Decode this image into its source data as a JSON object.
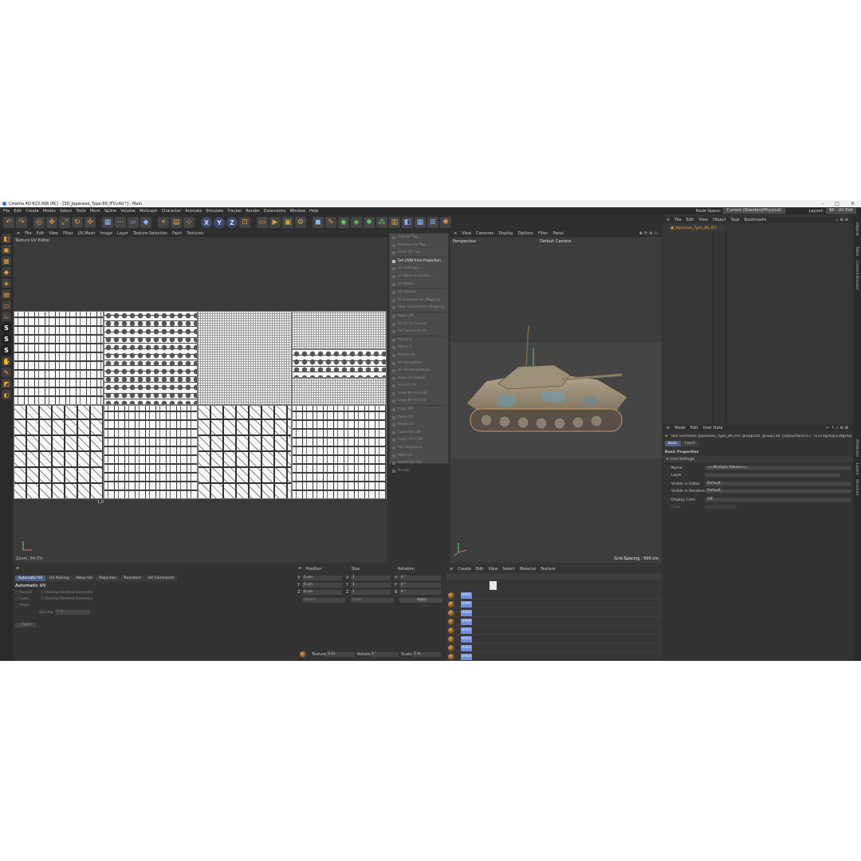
{
  "window": {
    "title": "Cinema 4D R23.008 (RC) - [3D_Japanese_Type-89_IFV.c4d *] - Main",
    "controls": [
      "–",
      "□",
      "✕"
    ]
  },
  "menubar": {
    "items": [
      "File",
      "Edit",
      "Create",
      "Modes",
      "Select",
      "Tools",
      "Mesh",
      "Spline",
      "Volume",
      "MoGraph",
      "Character",
      "Animate",
      "Simulate",
      "Tracker",
      "Render",
      "Extensions",
      "Window",
      "Help"
    ],
    "node_space_label": "Node Space:",
    "node_space_value": "Current (Standard/Physical)",
    "layout_label": "Layout:",
    "layout_value": "BP - UV Edit"
  },
  "uv_panel": {
    "menu": [
      "File",
      "Edit",
      "View",
      "Filter",
      "UV Mesh",
      "Image",
      "Layer",
      "Texture Selection",
      "Paint",
      "Textures"
    ],
    "title": "Texture UV Editor",
    "label_top_right": "1",
    "label_bottom": "1,0",
    "zoom": "Zoom: 64.0%"
  },
  "uv_menu": {
    "items": [
      {
        "label": "Add UV Tag",
        "active": false
      },
      {
        "label": "Remove UV Tag",
        "active": false
      },
      {
        "label": "Clear UV Tag",
        "active": false
      },
      {
        "sep": true
      },
      {
        "label": "Set UVW from Projection...",
        "active": true
      },
      {
        "label": "UV Settings...",
        "active": false
      },
      {
        "label": "UV Mesh to Points...",
        "active": false
      },
      {
        "label": "UV Mesh",
        "active": false
      },
      {
        "sep": true
      },
      {
        "label": "UV Islands",
        "active": false
      },
      {
        "label": "Fit Selected for Mapping",
        "active": false
      },
      {
        "label": "Stop Selected for Mapping",
        "active": false
      },
      {
        "sep": true
      },
      {
        "label": "Relax UV",
        "active": false
      },
      {
        "label": "Fit UV to Canvas",
        "active": false
      },
      {
        "label": "Fit Canvas to UV",
        "active": false
      },
      {
        "sep": true
      },
      {
        "label": "Mirror U",
        "active": false
      },
      {
        "label": "Mirror V",
        "active": false
      },
      {
        "label": "Rotate UV",
        "active": false
      },
      {
        "label": "UV Straighten",
        "active": false
      },
      {
        "label": "UV Rectangularize",
        "active": false
      },
      {
        "label": "Align UV Islands",
        "active": false
      },
      {
        "label": "Stretch UV",
        "active": false
      },
      {
        "label": "Snap Pin on Grid",
        "active": false
      },
      {
        "label": "Snap Pin to Grid",
        "active": false
      },
      {
        "sep": true
      },
      {
        "label": "Copy UV",
        "active": false
      },
      {
        "label": "Paste UV",
        "active": false
      },
      {
        "label": "Reset UV",
        "active": false
      },
      {
        "label": "Cycle UV CW",
        "active": false
      },
      {
        "label": "Cycle UV CCW",
        "active": false
      },
      {
        "label": "Flip Sequence",
        "active": false
      },
      {
        "label": "Weld UV",
        "active": false
      },
      {
        "label": "Subdivide UV",
        "active": false
      },
      {
        "label": "Terrain",
        "active": false
      }
    ]
  },
  "viewport": {
    "menu": [
      "View",
      "Cameras",
      "Display",
      "Options",
      "Filter",
      "Panel"
    ],
    "view_label": "Perspective",
    "camera_label": "Default Camera",
    "grid_spacing": "Grid Spacing : 500 cm"
  },
  "objects": {
    "menu": [
      "File",
      "Edit",
      "View",
      "Object",
      "Tags",
      "Bookmarks"
    ],
    "object_name": "Japanese_Type_89_IFV"
  },
  "right_tabs": [
    "Objects",
    "Takes",
    "Content Browser",
    "Attributes",
    "Layers",
    "Structure"
  ],
  "attributes": {
    "menu": [
      "Mode",
      "Edit",
      "User Data"
    ],
    "summary": "604 Elements [Japanese_Type_89_IFV, group120, group136, polySurface157, TE371group139group152polySurf...",
    "tabs": [
      "Basic",
      "Coord."
    ],
    "section_title": "Basic Properties",
    "subsection": "Icon Settings",
    "rows": [
      {
        "label": "Name",
        "value": "<<Multiple Values>>"
      },
      {
        "label": "Layer",
        "value": ""
      },
      {
        "label": "Visible in Editor",
        "value": "Default"
      },
      {
        "label": "Visible in Renderer",
        "value": "Default"
      },
      {
        "label": "Display Color",
        "value": "Off"
      },
      {
        "label": "Color",
        "value": ""
      }
    ]
  },
  "bottom_left": {
    "tabs": [
      "Automatic UV",
      "UV Packing",
      "Relax UV",
      "Projection",
      "Transform",
      "UV Commands"
    ],
    "section": "Automatic UV",
    "options": [
      "Packed",
      "Cubic",
      "Angle"
    ],
    "checks": [
      "Overlap Identical Geometry",
      "Overlap Mirrored Geometry"
    ],
    "spacing_label": "Spacing",
    "spacing_value": "1 %",
    "apply": "Apply"
  },
  "coords": {
    "headers": [
      "Position",
      "Size",
      "Rotation"
    ],
    "rows": [
      {
        "axis": "X",
        "pos": "0 cm",
        "size_axis": "X",
        "size": "1",
        "rot_axis": "H",
        "rot": "0 °"
      },
      {
        "axis": "Y",
        "pos": "0 cm",
        "size_axis": "Y",
        "size": "1",
        "rot_axis": "P",
        "rot": "0 °"
      },
      {
        "axis": "Z",
        "pos": "0 cm",
        "size_axis": "Z",
        "size": "1",
        "rot_axis": "B",
        "rot": "0 °"
      }
    ],
    "mode1": "Object",
    "mode2": "Scale",
    "apply": "Apply",
    "texture_label": "Texture",
    "texture_value": "0.01",
    "rotate_label": "Rotate",
    "rotate_value": "5 °",
    "scale_label": "Scale",
    "scale_value": "5 %"
  },
  "materials": {
    "menu": [
      "Create",
      "Edit",
      "View",
      "Select",
      "Material",
      "Texture"
    ],
    "tags": [
      "UV01",
      "UV02",
      "UV03",
      "UV04",
      "UV11",
      "UV12",
      "UV13",
      "UV14"
    ]
  }
}
